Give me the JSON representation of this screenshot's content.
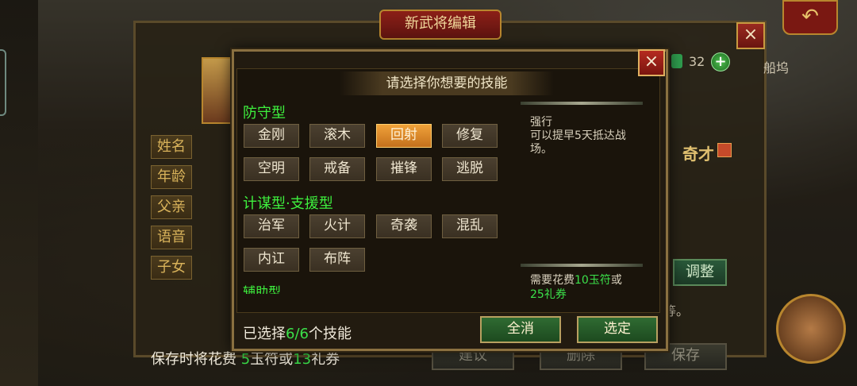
{
  "editor": {
    "title": "新武将编辑",
    "close_icon": "×",
    "back_icon": "↶",
    "resource_count": "32",
    "plus_icon": "+",
    "right_name": "船坞",
    "qicai": "奇才",
    "adjust": "调整",
    "etc": "等。",
    "labels": [
      "姓名",
      "年龄",
      "父亲",
      "语音",
      "子女"
    ],
    "bottom_buttons": [
      "建议",
      "删除",
      "保存"
    ],
    "save_note": {
      "prefix": "保存时将花费 ",
      "jade": "5",
      "mid": "玉符或",
      "coupon": "13",
      "suffix": "礼券"
    }
  },
  "modal": {
    "title": "请选择你想要的技能",
    "close_icon": "×",
    "categories": [
      {
        "name": "防守型",
        "skills": [
          "金刚",
          "滚木",
          "回射",
          "修复",
          "空明",
          "戒备",
          "摧锋",
          "逃脱"
        ]
      },
      {
        "name": "计谋型·支援型",
        "skills": [
          "治军",
          "火计",
          "奇袭",
          "混乱",
          "内讧",
          "布阵"
        ]
      },
      {
        "name": "辅助型",
        "skills": []
      }
    ],
    "selected_skill": "回射",
    "description": {
      "title": "强行",
      "body": "可以提早5天抵达战场。"
    },
    "cost": {
      "prefix": "需要花费",
      "jade": "10玉符",
      "mid": "或",
      "coupon": "25礼券"
    },
    "footer": {
      "prefix": "已选择",
      "count": "6/6",
      "suffix": "个技能"
    },
    "buttons": {
      "clear": "全消",
      "confirm": "选定"
    }
  },
  "colors": {
    "accent_green": "#3be04a",
    "selected_orange": "#f0a23a",
    "frame_gold": "#b8862e",
    "close_red": "#b52a20"
  }
}
